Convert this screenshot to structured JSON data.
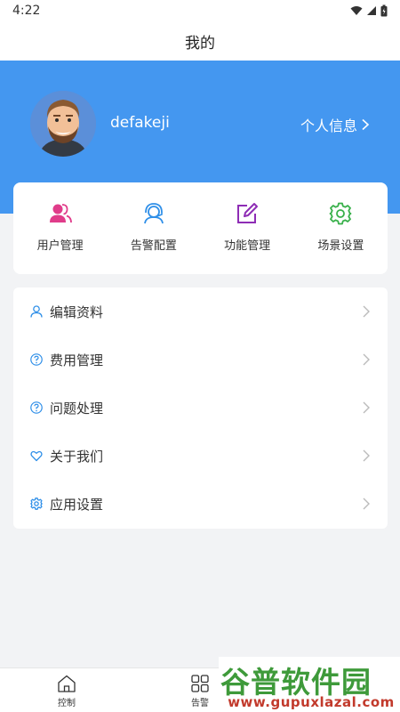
{
  "status_bar": {
    "time": "4:22"
  },
  "header": {
    "title": "我的"
  },
  "profile": {
    "username": "defakeji",
    "info_link": "个人信息"
  },
  "quick_actions": [
    {
      "label": "用户管理",
      "icon": "users-icon",
      "color": "#e03c8a"
    },
    {
      "label": "告警配置",
      "icon": "alarm-headset-icon",
      "color": "#2f8fe8"
    },
    {
      "label": "功能管理",
      "icon": "edit-icon",
      "color": "#8e2db5"
    },
    {
      "label": "场景设置",
      "icon": "gear-icon",
      "color": "#38b04a"
    }
  ],
  "menu": [
    {
      "label": "编辑资料",
      "icon": "person-icon"
    },
    {
      "label": "费用管理",
      "icon": "question-circle-icon"
    },
    {
      "label": "问题处理",
      "icon": "question-circle-icon"
    },
    {
      "label": "关于我们",
      "icon": "heart-icon"
    },
    {
      "label": "应用设置",
      "icon": "gear-icon"
    }
  ],
  "tabbar": {
    "tabs": [
      {
        "label": "控制",
        "icon": "home-icon"
      },
      {
        "label": "告警",
        "icon": "grid-icon"
      }
    ]
  },
  "watermark": {
    "title": "谷普软件园",
    "url": "www.gupuxlazal.com"
  },
  "colors": {
    "primary": "#4497f0",
    "menu_icon": "#2f8fe8"
  }
}
